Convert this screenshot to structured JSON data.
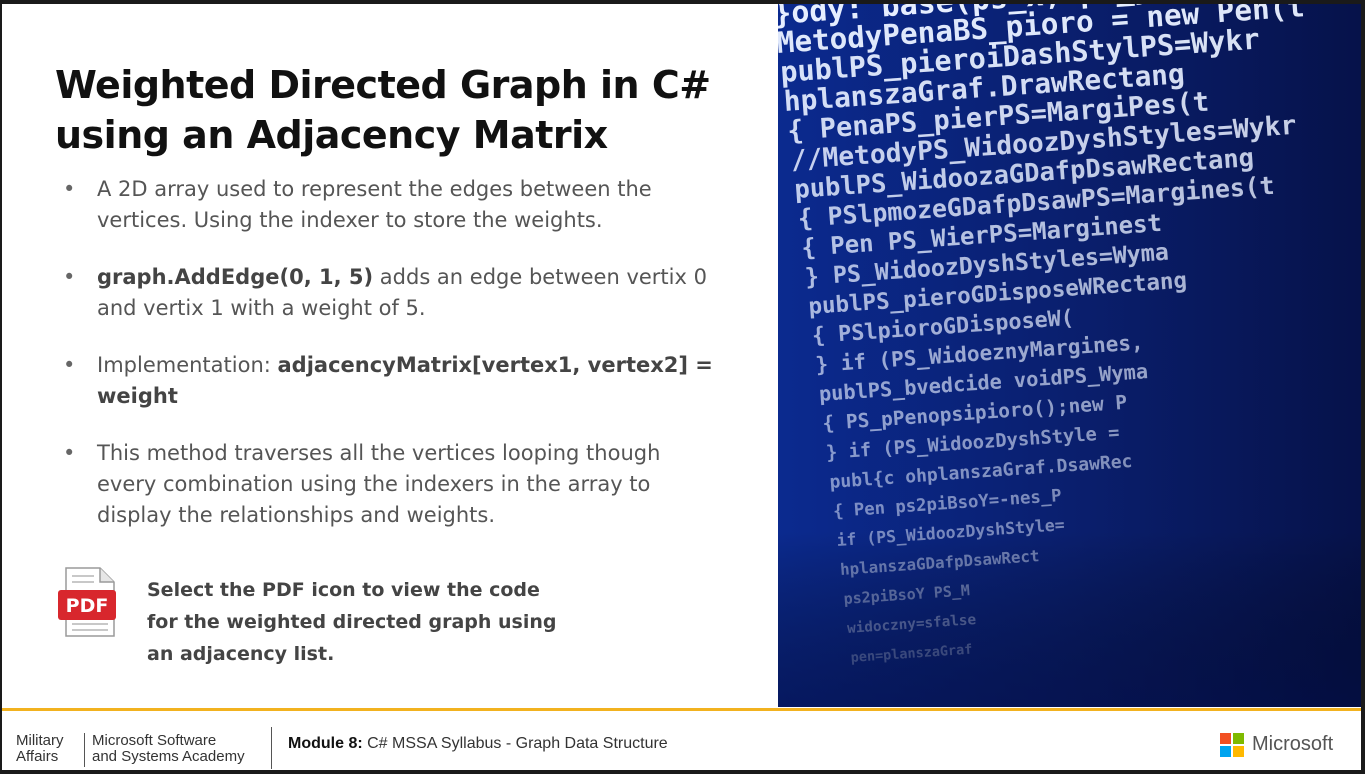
{
  "slide": {
    "title": "Weighted Directed Graph in C# using an Adjacency Matrix",
    "bullets": [
      {
        "bold_lead": "",
        "text": "A 2D array used to represent the edges between the vertices. Using the indexer to store the weights.",
        "bold_tail": ""
      },
      {
        "bold_lead": "graph.AddEdge(0, 1, 5)",
        "text": " adds an edge between vertix 0 and vertix 1 with a weight of 5.",
        "bold_tail": ""
      },
      {
        "bold_lead": "",
        "text": "Implementation: ",
        "bold_tail": "adjacencyMatrix[vertex1, vertex2] = weight"
      },
      {
        "bold_lead": "",
        "text": "This method traverses all the vertices looping though every combination using the indexers in the array to display the relationships and weights.",
        "bold_tail": ""
      }
    ],
    "bullet_glyph": "•",
    "pdf_icon_label": "PDF",
    "pdf_note": "Select the PDF icon to view the code for the weighted directed graph using an adjacency list."
  },
  "photo": {
    "code_lines": [
      "}ody: base(ps_x, ps_y)",
      "MetodyPenaBS_pioro = new Pen(t",
      "publPS_pieroiDashStylPS=Wykr",
      "  hplanszaGraf.DrawRectang",
      "  {  PenaPS_pierPS=MargiPes(t",
      "//MetodyPS_WidoozDyshStyles=Wykr",
      "  publPS_WidoozaGDafpDsawRectang",
      "   { PSlpmozeGDafpDsawPS=Margines(t",
      "   { Pen PS_WierPS=Marginest",
      "   } PS_WidoozDyshStyles=Wyma",
      "  publPS_pieroGDisposeWRectang",
      "   {  PSlpioroGDisposeW(",
      "   } if (PS_WidoeznyMargines,",
      "  publPS_bvedcide voidPS_Wyma",
      "   { PS_pPenopsipioro();new P",
      "   } if (PS_WidoozDyshStyle =",
      "  publ{c ohplanszaGraf.DsawRec",
      "   {  Pen ps2piBsoY=-nes_P",
      "       if (PS_WidoozDyshStyle=",
      "        hplanszaGDafpDsawRect",
      "          ps2piBsoY  PS_M",
      "        widoczny=sfalse",
      "        pen=planszaGraf"
    ]
  },
  "footer": {
    "org_line1": "Military",
    "org_line2": "Affairs",
    "academy_line1": "Microsoft Software",
    "academy_line2": "and Systems Academy",
    "module_label": "Module 8:",
    "module_text": " C# MSSA Syllabus - Graph Data Structure",
    "brand": "Microsoft"
  },
  "colors": {
    "footer_accent": "#f2b21f",
    "pdf_red": "#d8272d",
    "ms_red": "#f25022",
    "ms_green": "#7fba00",
    "ms_blue": "#00a4ef",
    "ms_yellow": "#ffb900"
  }
}
